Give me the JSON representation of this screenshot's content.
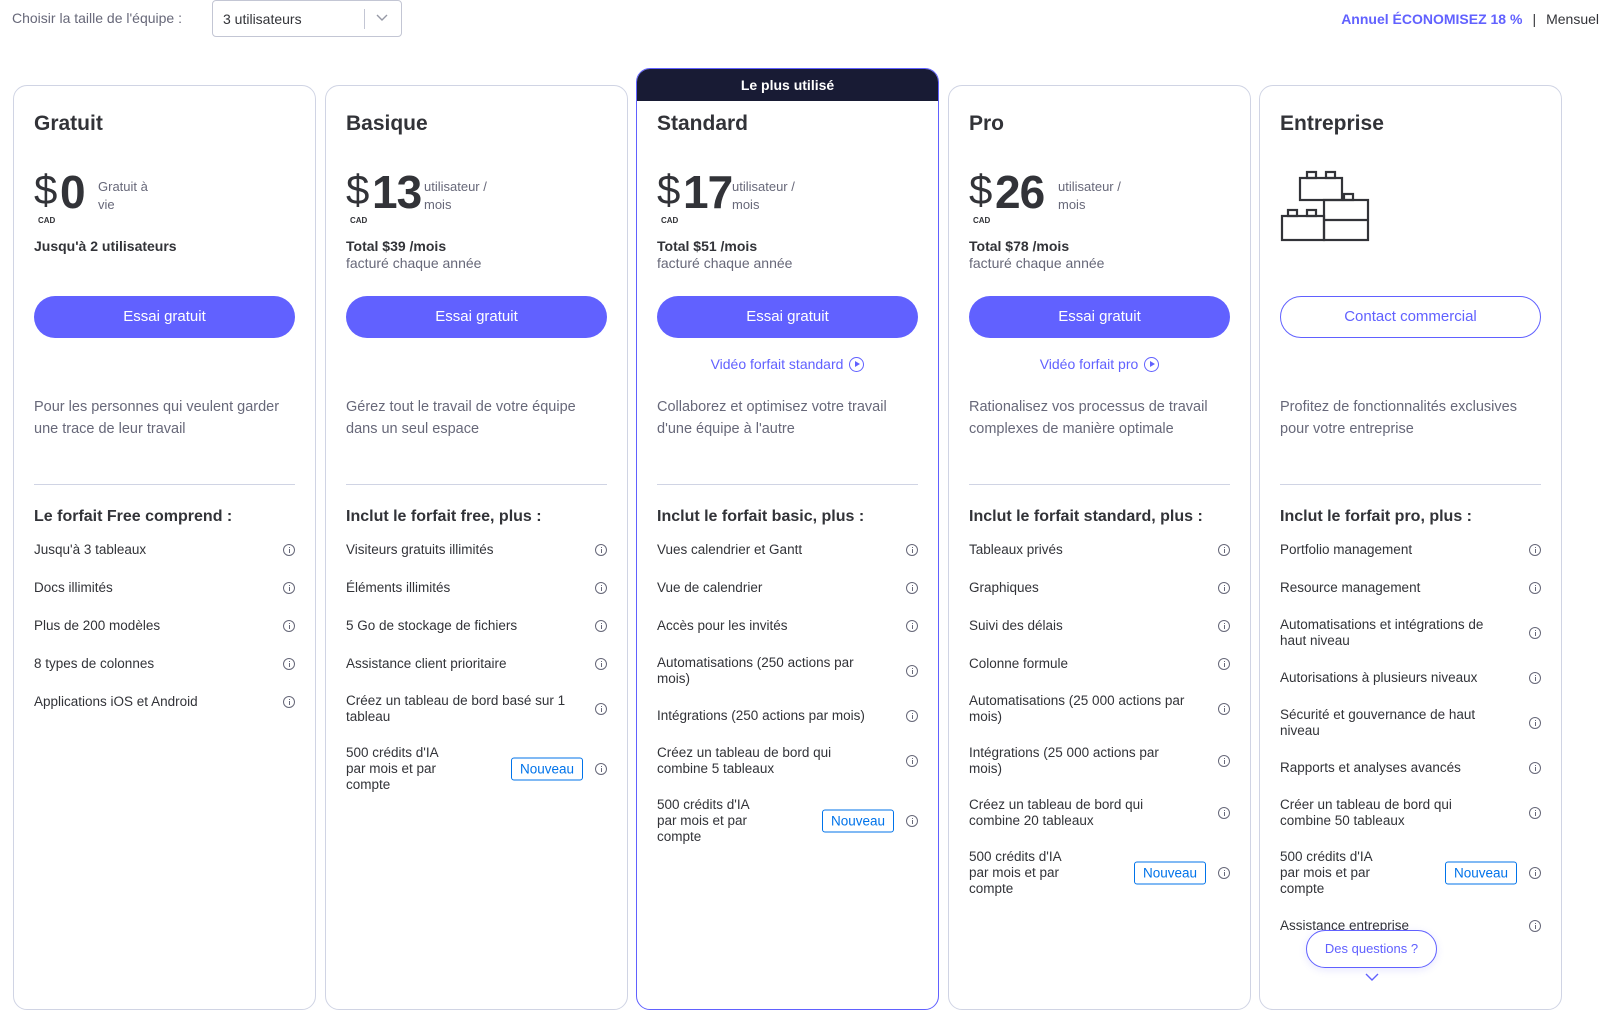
{
  "header": {
    "team_label": "Choisir la taille de l'équipe :",
    "team_value": "3 utilisateurs",
    "annual_label": "Annuel ÉCONOMISEZ 18 %",
    "separator": "|",
    "monthly_label": "Mensuel"
  },
  "colors": {
    "accent": "#6161ff",
    "dark_banner": "#181b34",
    "badge_blue": "#0073ea"
  },
  "plans": [
    {
      "name": "Gratuit",
      "currency_symbol": "$",
      "amount": "0",
      "currency": "CAD",
      "per": "Gratuit à vie",
      "total": "Jusqu'à 2 utilisateurs",
      "billed": "",
      "cta": "Essai gratuit",
      "video": "",
      "description": "Pour les personnes qui veulent garder une trace de leur travail",
      "features_title": "Le forfait Free comprend :",
      "features": [
        "Jusqu'à 3 tableaux",
        "Docs illimités",
        "Plus de 200 modèles",
        "8 types de colonnes",
        "Applications iOS et Android"
      ]
    },
    {
      "name": "Basique",
      "currency_symbol": "$",
      "amount": "13",
      "currency": "CAD",
      "per": "utilisateur / mois",
      "total": "Total $39 /mois",
      "billed": "facturé chaque année",
      "cta": "Essai gratuit",
      "video": "",
      "description": "Gérez tout le travail de votre équipe dans un seul espace",
      "features_title": "Inclut le forfait free, plus :",
      "features": [
        "Visiteurs gratuits illimités",
        "Éléments illimités",
        "5 Go de stockage de fichiers",
        "Assistance client prioritaire",
        "Créez un tableau de bord basé sur 1 tableau"
      ],
      "ai_feature": "500 crédits d'IA par mois et par compte",
      "badge": "Nouveau"
    },
    {
      "name": "Standard",
      "banner": "Le plus utilisé",
      "currency_symbol": "$",
      "amount": "17",
      "currency": "CAD",
      "per": "utilisateur / mois",
      "total": "Total $51 /mois",
      "billed": "facturé chaque année",
      "cta": "Essai gratuit",
      "video": "Vidéo forfait standard",
      "description": "Collaborez et optimisez votre travail d'une équipe à l'autre",
      "features_title": "Inclut le forfait basic, plus :",
      "features": [
        "Vues calendrier et Gantt",
        "Vue de calendrier",
        "Accès pour les invités",
        "Automatisations (250 actions par mois)",
        "Intégrations (250 actions par mois)",
        "Créez un tableau de bord qui combine 5 tableaux"
      ],
      "ai_feature": "500 crédits d'IA par mois et par compte",
      "badge": "Nouveau"
    },
    {
      "name": "Pro",
      "currency_symbol": "$",
      "amount": "26",
      "currency": "CAD",
      "per": "utilisateur / mois",
      "total": "Total $78 /mois",
      "billed": "facturé chaque année",
      "cta": "Essai gratuit",
      "video": "Vidéo forfait pro",
      "description": "Rationalisez vos processus de travail complexes de manière optimale",
      "features_title": "Inclut le forfait standard, plus :",
      "features": [
        "Tableaux privés",
        "Graphiques",
        "Suivi des délais",
        "Colonne formule",
        "Automatisations (25 000 actions par mois)",
        "Intégrations (25 000 actions par mois)",
        "Créez un tableau de bord qui combine 20 tableaux"
      ],
      "ai_feature": "500 crédits d'IA par mois et par compte",
      "badge": "Nouveau"
    },
    {
      "name": "Entreprise",
      "cta": "Contact commercial",
      "description": "Profitez de fonctionnalités exclusives pour votre entreprise",
      "features_title": "Inclut le forfait pro, plus :",
      "features": [
        "Portfolio management",
        "Resource management",
        "Automatisations et intégrations de haut niveau",
        "Autorisations à plusieurs niveaux",
        "Sécurité et gouvernance de haut niveau",
        "Rapports et analyses avancés",
        "Créer un tableau de bord qui combine 50 tableaux"
      ],
      "ai_feature": "500 crédits d'IA par mois et par compte",
      "badge": "Nouveau",
      "last_feature": "Assistance entreprise"
    }
  ],
  "help_button": "Des questions ?"
}
